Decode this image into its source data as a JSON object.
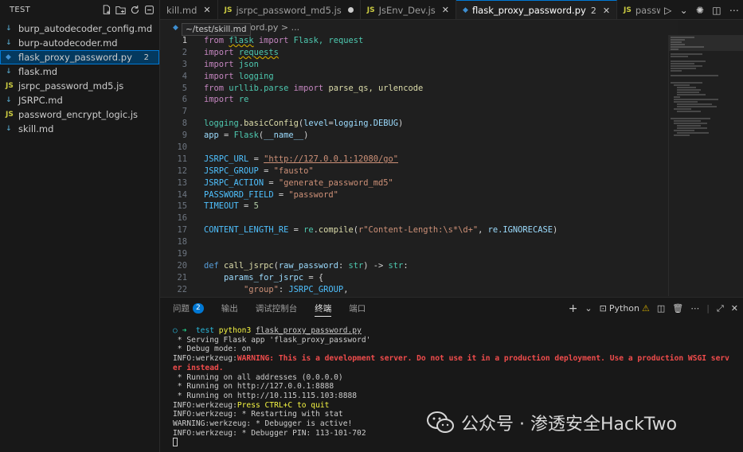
{
  "explorer": {
    "title": "TEST",
    "files": [
      {
        "name": "burp_autodecoder_config.md",
        "type": "md",
        "active": false,
        "badge": ""
      },
      {
        "name": "burp-autodecoder.md",
        "type": "md",
        "active": false,
        "badge": ""
      },
      {
        "name": "flask_proxy_password.py",
        "type": "py",
        "active": true,
        "badge": "2"
      },
      {
        "name": "flask.md",
        "type": "md",
        "active": false,
        "badge": ""
      },
      {
        "name": "jsrpc_password_md5.js",
        "type": "js",
        "active": false,
        "badge": ""
      },
      {
        "name": "JSRPC.md",
        "type": "md",
        "active": false,
        "badge": ""
      },
      {
        "name": "password_encrypt_logic.js",
        "type": "js",
        "active": false,
        "badge": ""
      },
      {
        "name": "skill.md",
        "type": "md",
        "active": false,
        "badge": ""
      }
    ]
  },
  "tabs": [
    {
      "label": "kill.md",
      "icon": "",
      "state": "close",
      "active": false
    },
    {
      "label": "jsrpc_password_md5.js",
      "icon": "JS",
      "state": "dirty",
      "active": false
    },
    {
      "label": "JsEnv_Dev.js",
      "icon": "JS",
      "state": "close",
      "active": false
    },
    {
      "label": "flask_proxy_password.py",
      "icon": "py",
      "state": "count",
      "count": "2",
      "active": true
    },
    {
      "label": "password_er",
      "icon": "JS",
      "state": "none",
      "active": false
    }
  ],
  "breadcrumb": {
    "text": "ssword.py > ...",
    "tooltip": "~/test/skill.md"
  },
  "code": {
    "current_line": "1",
    "lines": [
      "1",
      "2",
      "3",
      "4",
      "5",
      "6",
      "7",
      "8",
      "9",
      "10",
      "11",
      "12",
      "13",
      "14",
      "15",
      "16",
      "17",
      "18",
      "19",
      "20",
      "21",
      "22"
    ],
    "tokens": {
      "from": "from",
      "import": "import",
      "flask": "flask",
      "Flask_req": "Flask, request",
      "requests": "requests",
      "json": "json",
      "logging": "logging",
      "urllib": "urllib.parse",
      "parse_names": "parse_qs, urlencode",
      "re": "re",
      "logging_mod": "logging",
      "basicConfig": "basicConfig",
      "level": "level",
      "logging_debug": "logging.DEBUG",
      "app": "app",
      "Flask": "Flask",
      "name": "__name__",
      "jsrpc_url": "JSRPC_URL",
      "jsrpc_url_val": "\"http://127.0.0.1:12080/go\"",
      "jsrpc_group": "JSRPC_GROUP",
      "jsrpc_group_val": "\"fausto\"",
      "jsrpc_action": "JSRPC_ACTION",
      "jsrpc_action_val": "\"generate_password_md5\"",
      "password_field": "PASSWORD_FIELD",
      "password_field_val": "\"password\"",
      "timeout": "TIMEOUT",
      "timeout_val": "5",
      "content_re": "CONTENT_LENGTH_RE",
      "re_mod": "re",
      "compile": "compile",
      "regex": "r\"Content-Length:\\s*\\d+\"",
      "re_i": "re.IGNORECASE",
      "def": "def",
      "call_jsrpc": "call_jsrpc",
      "raw_password": "raw_password",
      "str": "str",
      "params": "params_for_jsrpc",
      "group_key": "\"group\"",
      "group_val": "JSRPC_GROUP"
    }
  },
  "panel": {
    "tabs": [
      {
        "label": "问题",
        "badge": "2",
        "active": false
      },
      {
        "label": "输出",
        "badge": "",
        "active": false
      },
      {
        "label": "调试控制台",
        "badge": "",
        "active": false
      },
      {
        "label": "终端",
        "badge": "",
        "active": true
      },
      {
        "label": "端口",
        "badge": "",
        "active": false
      }
    ],
    "profile": "Python"
  },
  "terminal": {
    "prompt_dir": "test",
    "command": "python3",
    "arg": "flask_proxy_password.py",
    "lines": [
      " * Serving Flask app 'flask_proxy_password'",
      " * Debug mode: on"
    ],
    "warn_prefix": "INFO:werkzeug:",
    "warn_msg": "WARNING: This is a development server. Do not use it in a production deployment. Use a production WSGI serv",
    "warn_msg2": "er instead.",
    "run_lines": [
      " * Running on all addresses (0.0.0.0)",
      " * Running on http://127.0.0.1:8888",
      " * Running on http://10.115.115.103:8888"
    ],
    "ctrlc_prefix": "INFO:werkzeug:",
    "ctrlc_msg": "Press CTRL+C to quit",
    "tail_lines": [
      "INFO:werkzeug: * Restarting with stat",
      "WARNING:werkzeug: * Debugger is active!",
      "INFO:werkzeug: * Debugger PIN: 113-101-702"
    ]
  },
  "watermark": {
    "text": "公众号 · 渗透安全HackTwo"
  },
  "colors": {
    "accent": "#0078d4",
    "warning": "#cca700",
    "error": "#f14c4c"
  }
}
